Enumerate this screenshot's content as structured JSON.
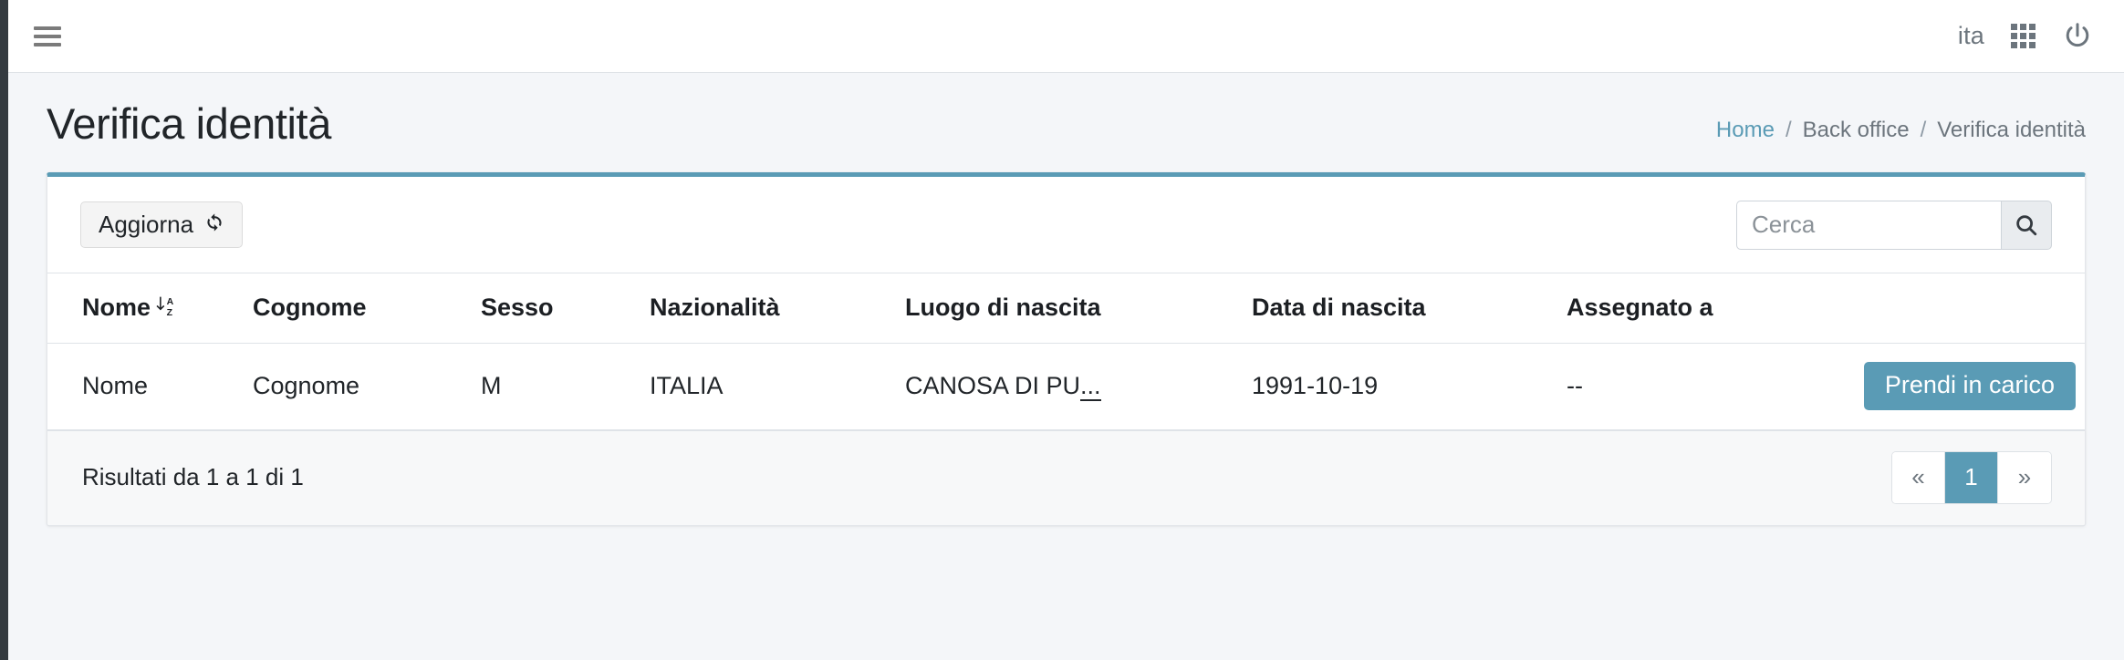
{
  "navbar": {
    "menu_toggle_label": "menu-toggle",
    "language": "ita",
    "apps_icon": "grid-apps-icon",
    "power_icon": "power-icon"
  },
  "header": {
    "title": "Verifica identità",
    "breadcrumb": [
      {
        "label": "Home",
        "type": "link"
      },
      {
        "label": "Back office",
        "type": "text"
      },
      {
        "label": "Verifica identità",
        "type": "current"
      }
    ],
    "separator": "/"
  },
  "toolbar": {
    "refresh_label": "Aggiorna",
    "refresh_icon": "refresh-icon",
    "search_placeholder": "Cerca",
    "search_value": "",
    "search_icon": "search-icon"
  },
  "table": {
    "columns": [
      {
        "label": "Nome",
        "sorted": true,
        "sort_icon": "sort-alpha-asc-icon"
      },
      {
        "label": "Cognome",
        "sorted": false
      },
      {
        "label": "Sesso",
        "sorted": false
      },
      {
        "label": "Nazionalità",
        "sorted": false
      },
      {
        "label": "Luogo di nascita",
        "sorted": false
      },
      {
        "label": "Data di nascita",
        "sorted": false
      },
      {
        "label": "Assegnato a",
        "sorted": false
      },
      {
        "label": "",
        "sorted": false
      }
    ],
    "rows": [
      {
        "nome": "Nome",
        "cognome": "Cognome",
        "sesso": "M",
        "nazionalita": "ITALIA",
        "luogo_di_nascita": "CANOSA DI PU",
        "luogo_truncation": "...",
        "data_di_nascita": "1991-10-19",
        "assegnato_a": "--",
        "action_label": "Prendi in carico"
      }
    ]
  },
  "footer": {
    "results_info": "Risultati da 1 a 1 di 1",
    "pagination": {
      "prev": "«",
      "next": "»",
      "pages": [
        {
          "label": "1",
          "active": true
        }
      ]
    }
  },
  "colors": {
    "accent": "#5a9bb5",
    "sidebar": "#343a40",
    "page_bg": "#f4f6f9",
    "muted_text": "#6c757d"
  }
}
